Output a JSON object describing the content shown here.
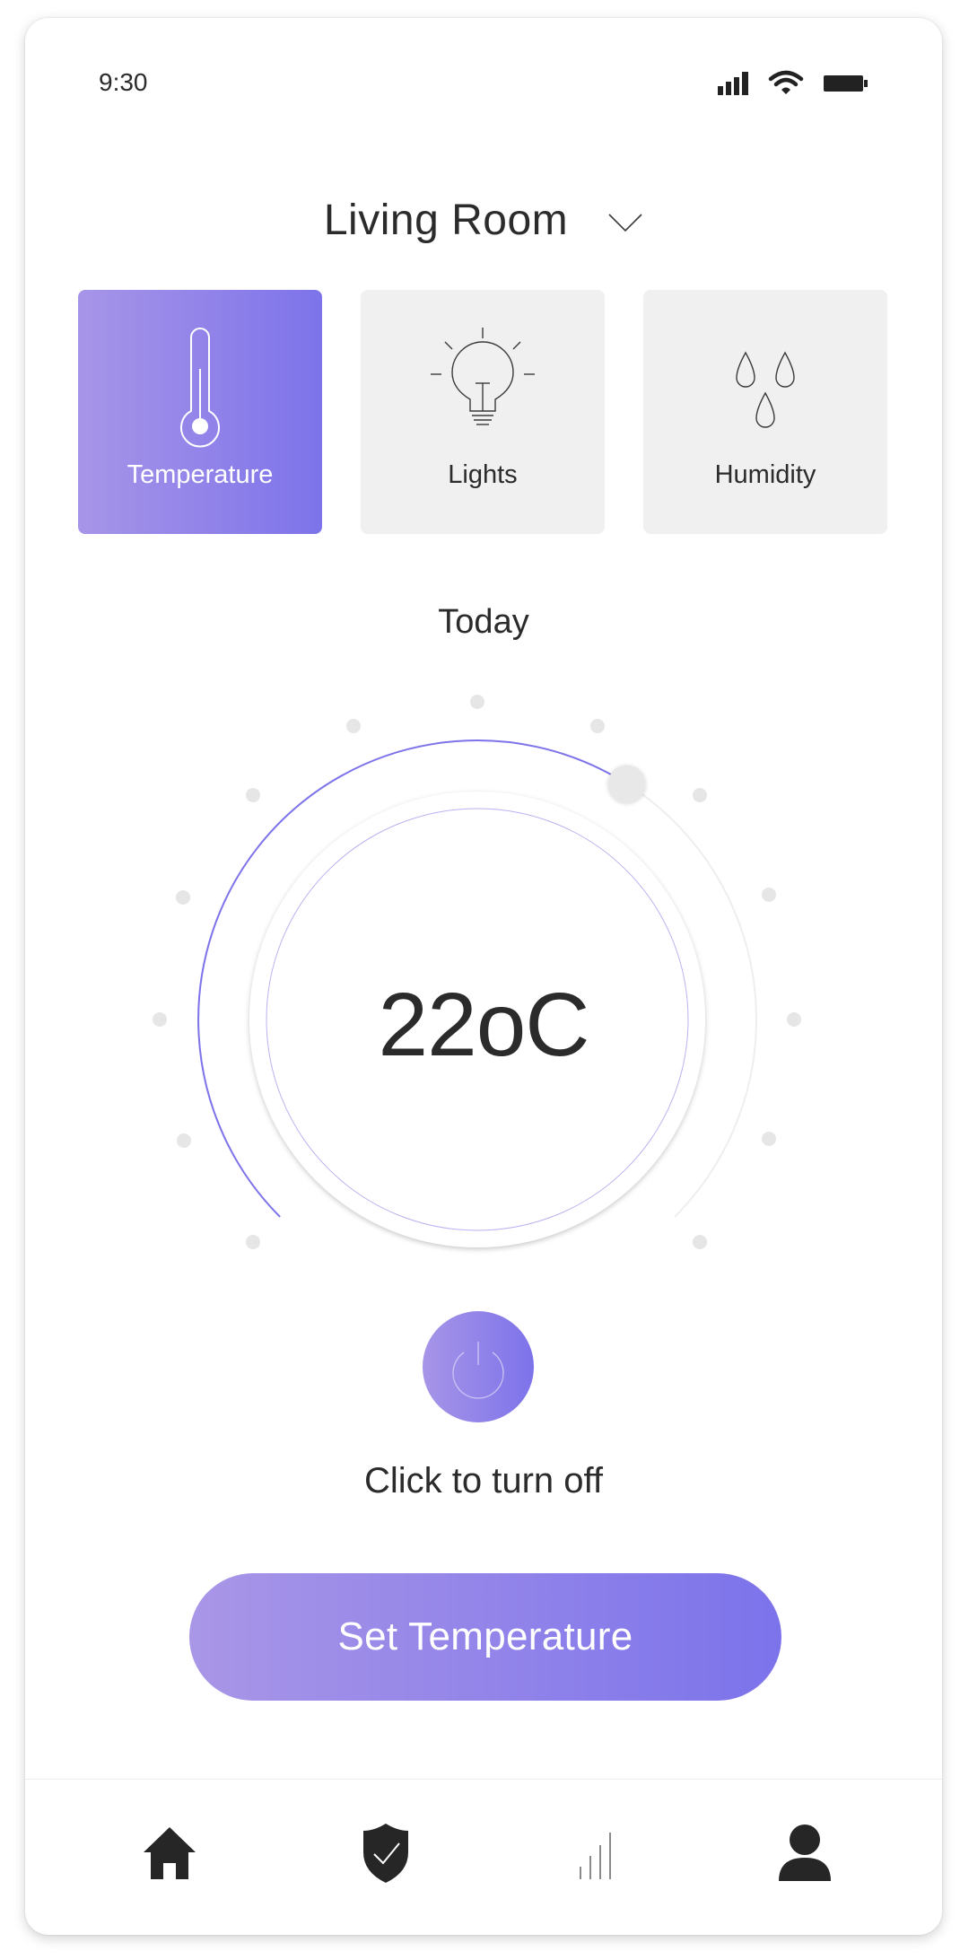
{
  "status_bar": {
    "time": "9:30",
    "icons": [
      "signal-icon",
      "wifi-icon",
      "battery-icon"
    ]
  },
  "header": {
    "room": "Living Room",
    "dropdown_icon": "chevron-down-icon"
  },
  "modes": [
    {
      "label": "Temperature",
      "icon": "thermometer-icon",
      "active": true
    },
    {
      "label": "Lights",
      "icon": "lightbulb-icon",
      "active": false
    },
    {
      "label": "Humidity",
      "icon": "droplets-icon",
      "active": false
    }
  ],
  "dial": {
    "period": "Today",
    "temperature": "22",
    "unit": "oC",
    "level_fraction": 0.62
  },
  "power": {
    "icon": "power-icon",
    "caption": "Click to turn off"
  },
  "actions": {
    "set_temperature": "Set Temperature"
  },
  "bottom_nav": [
    {
      "icon": "home-icon"
    },
    {
      "icon": "shield-check-icon"
    },
    {
      "icon": "bar-chart-icon"
    },
    {
      "icon": "user-icon"
    }
  ],
  "colors": {
    "accent_start": "#a795e8",
    "accent_end": "#7d73ea",
    "tile_inactive": "#f0f0f0",
    "text": "#2b2b2b"
  }
}
